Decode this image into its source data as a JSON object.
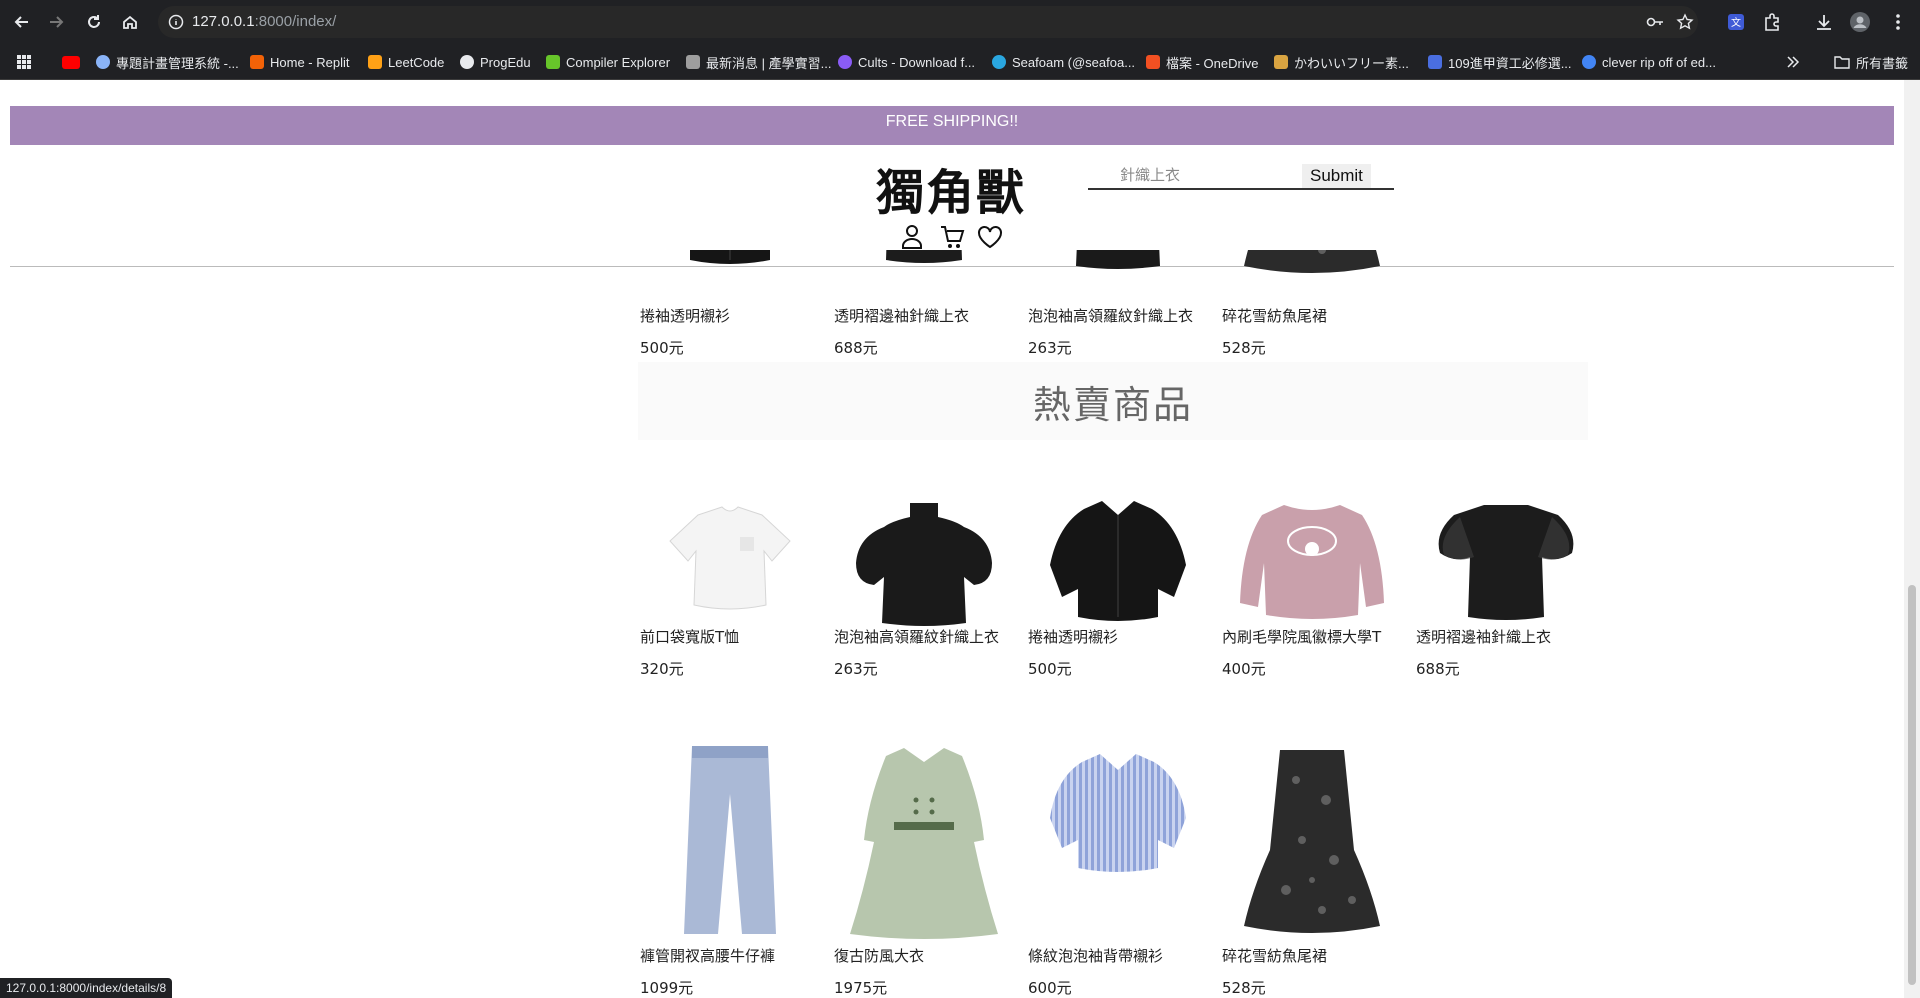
{
  "browser": {
    "url_host": "127.0.0.1",
    "url_path": ":8000/index/",
    "bookmarks": [
      {
        "label": "",
        "color": "#ff0000"
      },
      {
        "label": "專題計畫管理系統 -...",
        "color": "#8ab4f8"
      },
      {
        "label": "Home - Replit",
        "color": "#f26207"
      },
      {
        "label": "LeetCode",
        "color": "#ffa116"
      },
      {
        "label": "ProgEdu",
        "color": "#e8eaed"
      },
      {
        "label": "Compiler Explorer",
        "color": "#67c52a"
      },
      {
        "label": "最新消息 | 產學實習...",
        "color": "#9e9e9e"
      },
      {
        "label": "Cults - Download f...",
        "color": "#8a5cf6"
      },
      {
        "label": "Seafoam (@seafoa...",
        "color": "#2aa7e0"
      },
      {
        "label": "檔案 - OneDrive",
        "color": "#f25022"
      },
      {
        "label": "かわいいフリー素...",
        "color": "#d9a441"
      },
      {
        "label": "109進甲資工必修選...",
        "color": "#4a6ee0"
      },
      {
        "label": "clever rip off of ed...",
        "color": "#4285f4"
      }
    ],
    "all_bookmarks_label": "所有書籤",
    "status_url": "127.0.0.1:8000/index/details/8"
  },
  "page": {
    "shipping_banner": "FREE SHIPPING!!",
    "logo": "獨角獸",
    "search": {
      "placeholder": "針織上衣",
      "submit_label": "Submit"
    },
    "colors": {
      "banner": "#a386b7"
    },
    "top_row": [
      {
        "name": "捲袖透明襯衫",
        "price": "500元",
        "kind": "black-shirt"
      },
      {
        "name": "透明褶邊袖針織上衣",
        "price": "688元",
        "kind": "black-ruffle"
      },
      {
        "name": "泡泡袖高領羅紋針織上衣",
        "price": "263元",
        "kind": "black-puff"
      },
      {
        "name": "碎花雪紡魚尾裙",
        "price": "528元",
        "kind": "floral-skirt"
      }
    ],
    "hot_title": "熱賣商品",
    "hot_row1": [
      {
        "name": "前口袋寬版T恤",
        "price": "320元",
        "kind": "white-tee"
      },
      {
        "name": "泡泡袖高領羅紋針織上衣",
        "price": "263元",
        "kind": "black-puff"
      },
      {
        "name": "捲袖透明襯衫",
        "price": "500元",
        "kind": "black-shirt"
      },
      {
        "name": "內刷毛學院風徽標大學T",
        "price": "400元",
        "kind": "pink-sweat"
      },
      {
        "name": "透明褶邊袖針織上衣",
        "price": "688元",
        "kind": "black-ruffle"
      }
    ],
    "hot_row2": [
      {
        "name": "褲管開衩高腰牛仔褲",
        "price": "1099元",
        "kind": "jeans"
      },
      {
        "name": "復古防風大衣",
        "price": "1975元",
        "kind": "trench"
      },
      {
        "name": "條紋泡泡袖背帶襯衫",
        "price": "600元",
        "kind": "stripe-shirt"
      },
      {
        "name": "碎花雪紡魚尾裙",
        "price": "528元",
        "kind": "floral-skirt"
      }
    ]
  }
}
